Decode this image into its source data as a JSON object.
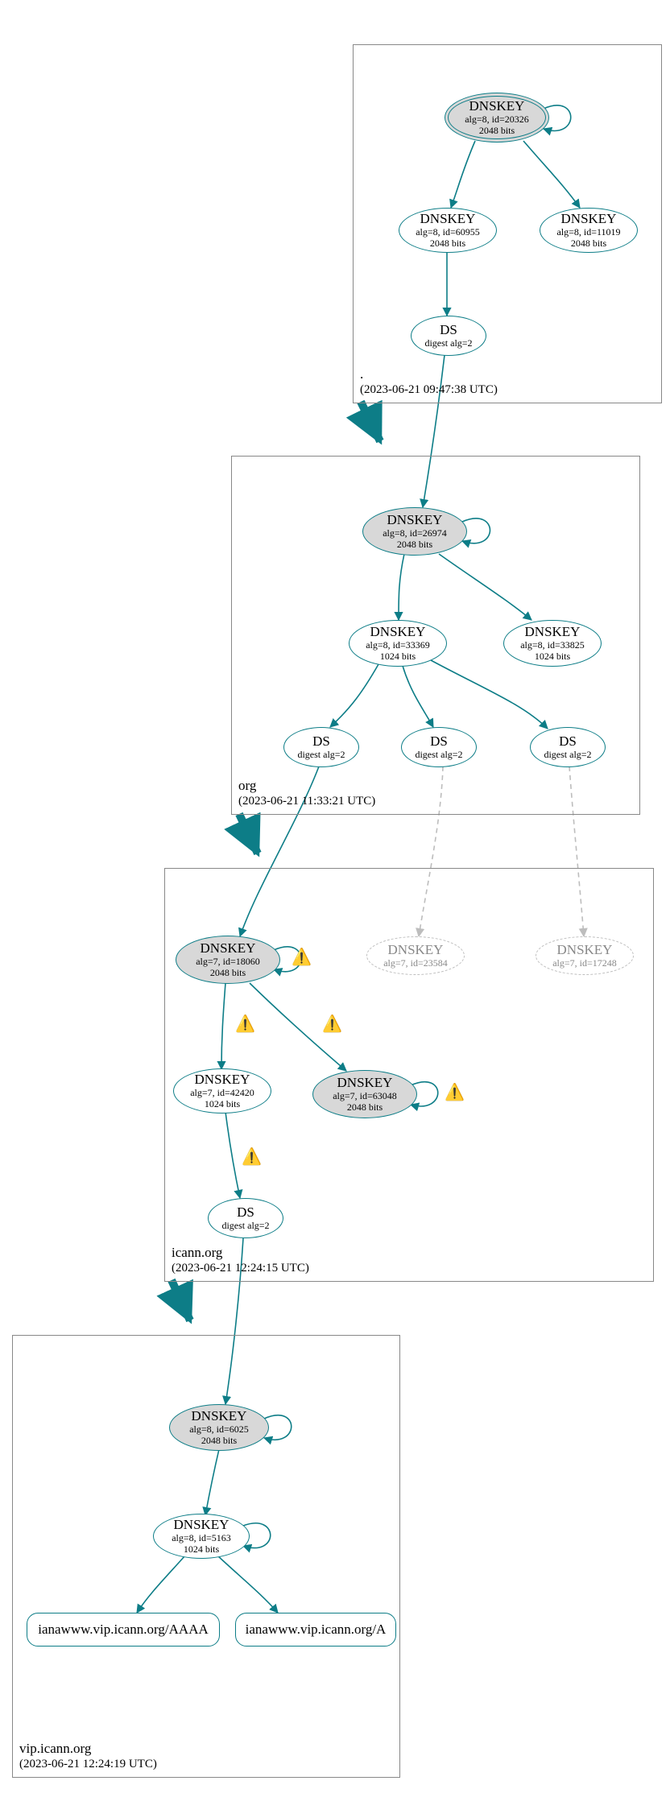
{
  "zones": {
    "root": {
      "name": ".",
      "timestamp": "(2023-06-21 09:47:38 UTC)"
    },
    "org": {
      "name": "org",
      "timestamp": "(2023-06-21 11:33:21 UTC)"
    },
    "icann": {
      "name": "icann.org",
      "timestamp": "(2023-06-21 12:24:15 UTC)"
    },
    "vip": {
      "name": "vip.icann.org",
      "timestamp": "(2023-06-21 12:24:19 UTC)"
    }
  },
  "nodes": {
    "root_ksk": {
      "title": "DNSKEY",
      "sub1": "alg=8, id=20326",
      "sub2": "2048 bits"
    },
    "root_zsk": {
      "title": "DNSKEY",
      "sub1": "alg=8, id=60955",
      "sub2": "2048 bits"
    },
    "root_zsk2": {
      "title": "DNSKEY",
      "sub1": "alg=8, id=11019",
      "sub2": "2048 bits"
    },
    "root_ds": {
      "title": "DS",
      "sub1": "digest alg=2",
      "sub2": ""
    },
    "org_ksk": {
      "title": "DNSKEY",
      "sub1": "alg=8, id=26974",
      "sub2": "2048 bits"
    },
    "org_zsk": {
      "title": "DNSKEY",
      "sub1": "alg=8, id=33369",
      "sub2": "1024 bits"
    },
    "org_zsk2": {
      "title": "DNSKEY",
      "sub1": "alg=8, id=33825",
      "sub2": "1024 bits"
    },
    "org_ds1": {
      "title": "DS",
      "sub1": "digest alg=2",
      "sub2": ""
    },
    "org_ds2": {
      "title": "DS",
      "sub1": "digest alg=2",
      "sub2": ""
    },
    "org_ds3": {
      "title": "DS",
      "sub1": "digest alg=2",
      "sub2": ""
    },
    "icann_ksk": {
      "title": "DNSKEY",
      "sub1": "alg=7, id=18060",
      "sub2": "2048 bits"
    },
    "icann_unk1": {
      "title": "DNSKEY",
      "sub1": "alg=7, id=23584",
      "sub2": ""
    },
    "icann_unk2": {
      "title": "DNSKEY",
      "sub1": "alg=7, id=17248",
      "sub2": ""
    },
    "icann_zsk": {
      "title": "DNSKEY",
      "sub1": "alg=7, id=42420",
      "sub2": "1024 bits"
    },
    "icann_ksk2": {
      "title": "DNSKEY",
      "sub1": "alg=7, id=63048",
      "sub2": "2048 bits"
    },
    "icann_ds": {
      "title": "DS",
      "sub1": "digest alg=2",
      "sub2": ""
    },
    "vip_ksk": {
      "title": "DNSKEY",
      "sub1": "alg=8, id=6025",
      "sub2": "2048 bits"
    },
    "vip_zsk": {
      "title": "DNSKEY",
      "sub1": "alg=8, id=5163",
      "sub2": "1024 bits"
    }
  },
  "rrsets": {
    "aaaa": "ianawww.vip.icann.org/AAAA",
    "a": "ianawww.vip.icann.org/A"
  },
  "colors": {
    "stroke": "#0d7d87",
    "dashed": "#bdbdbd"
  }
}
